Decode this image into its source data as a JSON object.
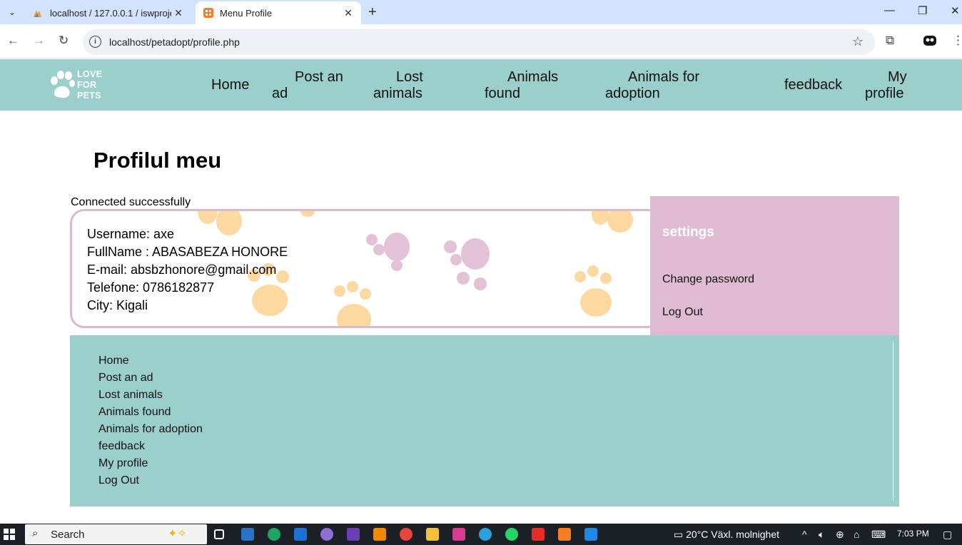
{
  "browser": {
    "tabs": [
      {
        "title": "localhost / 127.0.0.1 / iswprojec",
        "active": false
      },
      {
        "title": "Menu Profile",
        "active": true
      }
    ],
    "url": "localhost/petadopt/profile.php"
  },
  "site": {
    "logo_text": [
      "LOVE",
      "FOR",
      "PETS"
    ],
    "nav": [
      {
        "line1": "Home",
        "line2": ""
      },
      {
        "line1": "Post an",
        "line2": "ad"
      },
      {
        "line1": "Lost",
        "line2": "animals"
      },
      {
        "line1": "Animals",
        "line2": "found"
      },
      {
        "line1": "Animals for",
        "line2": "adoption"
      },
      {
        "line1": "feedback",
        "line2": ""
      },
      {
        "line1": "My",
        "line2": "profile"
      }
    ],
    "colors": {
      "header_bg": "#9acfcc",
      "settings_bg": "#dfbcd3",
      "paw_orange": "#fdd8a0",
      "paw_pink": "#e3c2d8"
    }
  },
  "main": {
    "title": "Profilul meu",
    "connection_status": "Connected successfully",
    "profile": {
      "username": "Username: axe",
      "fullname": "FullName : ABASABEZA HONORE",
      "email": "E-mail: absbzhonore@gmail.com",
      "phone": "Telefone: 0786182877",
      "city": "City: Kigali"
    },
    "settings": {
      "heading": "settings",
      "change_password": "Change password",
      "logout": "Log Out"
    }
  },
  "footer": {
    "links": [
      "Home",
      "Post an ad",
      "Lost animals",
      "Animals found",
      "Animals for adoption",
      "feedback",
      "My profile",
      "Log Out"
    ]
  },
  "taskbar": {
    "search_label": "Search",
    "weather": "20°C  Växl. molnighet",
    "time": "7:03 PM"
  }
}
